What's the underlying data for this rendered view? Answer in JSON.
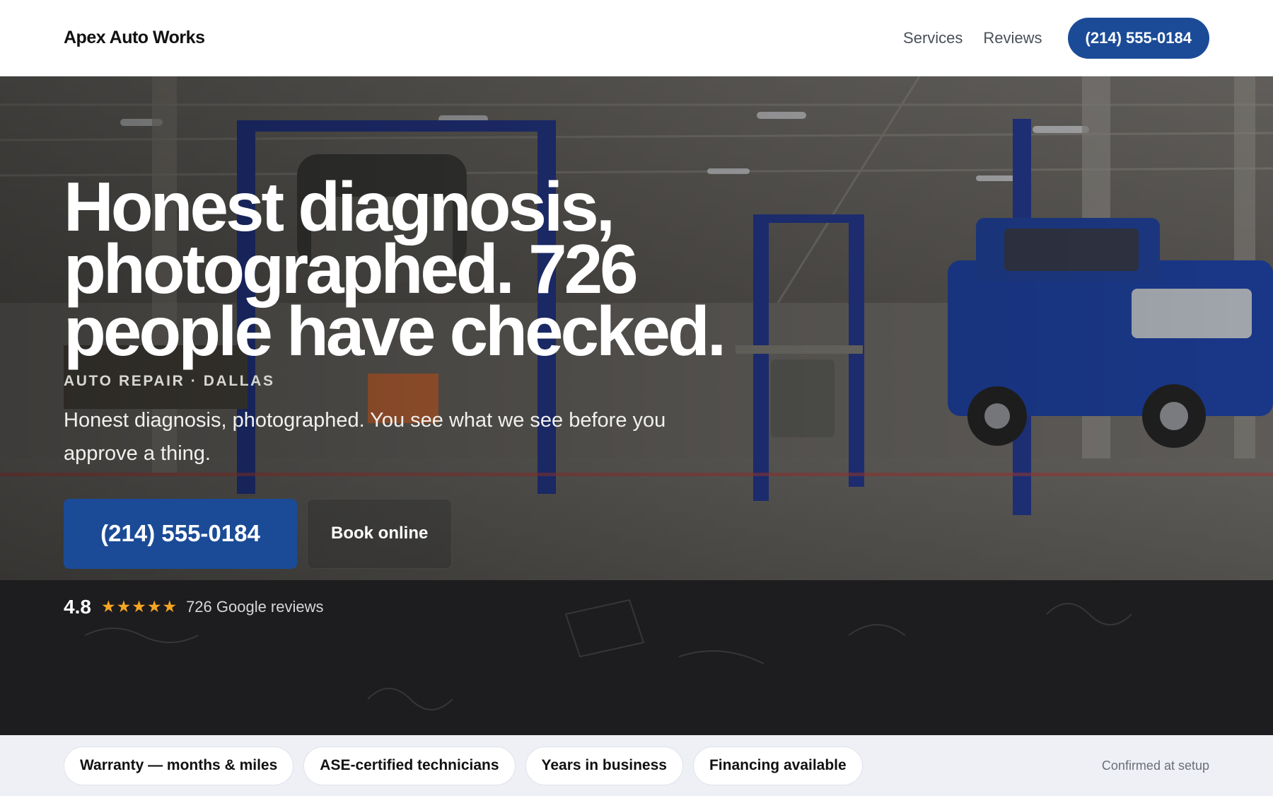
{
  "header": {
    "brand": "Apex Auto Works",
    "nav": [
      "Services",
      "Reviews"
    ],
    "phone_button": "(214) 555-0184"
  },
  "hero": {
    "headline": "Honest diagnosis, photographed. 726 people have checked.",
    "eyebrow": "AUTO REPAIR · DALLAS",
    "subheadline": "Honest diagnosis, photographed. You see what we see before you approve a thing.",
    "primary_cta": "(214) 555-0184",
    "secondary_cta": "Book online",
    "rating": {
      "score": "4.8",
      "stars": 5,
      "review_count_text": "726 Google reviews"
    }
  },
  "trust_bar": {
    "chips": [
      "Warranty — months & miles",
      "ASE-certified technicians",
      "Years in business",
      "Financing available"
    ],
    "note": "Confirmed at setup"
  },
  "colors": {
    "accent": "#1b4b97",
    "star": "#f5a623",
    "trust_bar_bg": "#eef0f6"
  },
  "icons": [
    "star-icon"
  ]
}
